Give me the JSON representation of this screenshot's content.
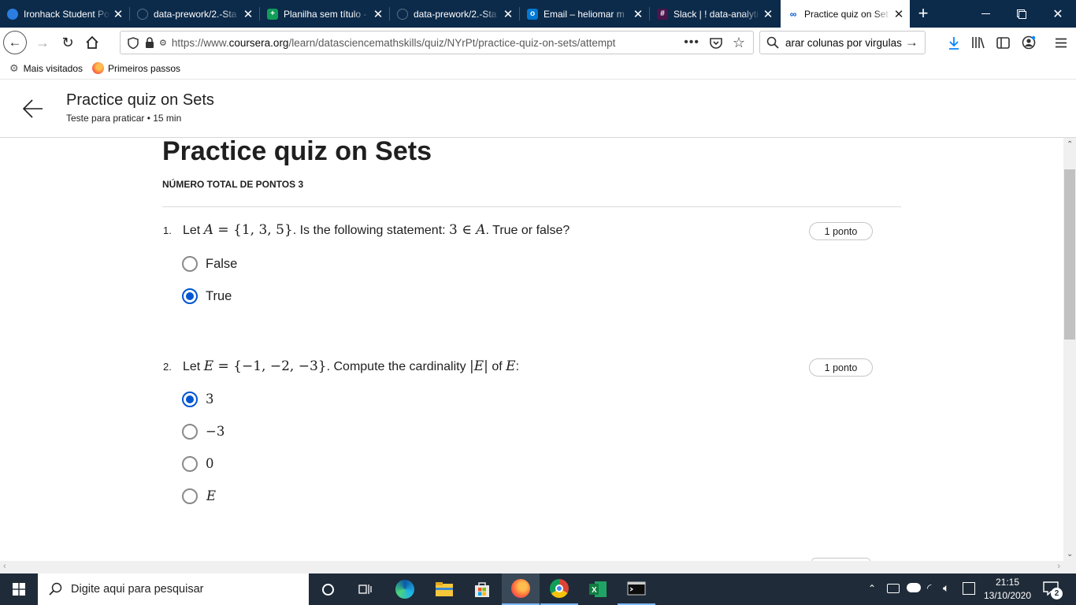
{
  "browser": {
    "tabs": [
      {
        "title": "Ironhack Student Po",
        "favicon_color": "#2a7de1"
      },
      {
        "title": "data-prework/2.-Sta",
        "favicon_color": "#24292e"
      },
      {
        "title": "Planilha sem título -",
        "favicon_color": "#0f9d58"
      },
      {
        "title": "data-prework/2.-Sta",
        "favicon_color": "#24292e"
      },
      {
        "title": "Email – heliomar m",
        "favicon_color": "#0078d4"
      },
      {
        "title": "Slack | ! data-analyti",
        "favicon_color": "#4a154b"
      },
      {
        "title": "Practice quiz on Set",
        "favicon_color": "#0056d2"
      }
    ],
    "url": {
      "prefix": "https://www.",
      "domain": "coursera.org",
      "path": "/learn/datasciencemathskills/quiz/NYrPt/practice-quiz-on-sets/attempt"
    },
    "search_value": "arar colunas por virgulas",
    "bookmarks": [
      "Mais visitados",
      "Primeiros passos"
    ]
  },
  "page_header": {
    "title": "Practice quiz on Sets",
    "subtitle": "Teste para praticar • 15 min"
  },
  "quiz": {
    "heading": "Practice quiz on Sets",
    "total_points": "NÚMERO TOTAL DE PONTOS 3",
    "questions": [
      {
        "number": "1.",
        "text_parts": [
          "Let ",
          "A",
          " = {1, 3, 5}",
          ". Is the following statement: ",
          "3 ∈ ",
          "A",
          ". True or false?"
        ],
        "points": "1 ponto",
        "options": [
          "False",
          "True"
        ],
        "selected": "True"
      },
      {
        "number": "2.",
        "text_parts": [
          "Let ",
          "E",
          " = {−1, −2, −3}",
          ". Compute the cardinality ",
          "|",
          "E",
          "|",
          " of ",
          "E",
          ":"
        ],
        "points": "1 ponto",
        "options": [
          "3",
          "−3",
          "0",
          "E"
        ],
        "selected": "3"
      }
    ]
  },
  "taskbar": {
    "search_placeholder": "Digite aqui para pesquisar",
    "time": "21:15",
    "date": "13/10/2020",
    "notification_count": "2"
  },
  "colors": {
    "accent": "#0056d2",
    "tabstrip": "#0c2a4a",
    "taskbar": "#1f2b38"
  }
}
